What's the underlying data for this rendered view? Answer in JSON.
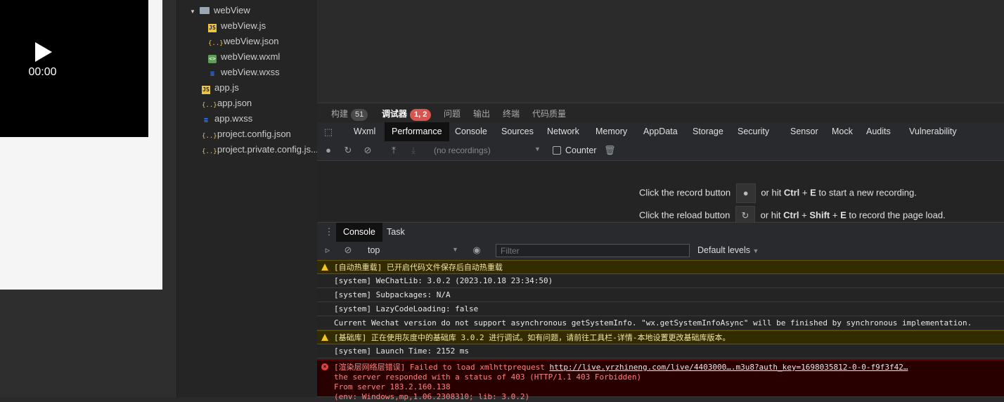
{
  "simulator": {
    "time": "00:00"
  },
  "tree": {
    "folder": "webView",
    "children": [
      {
        "name": "webView.js",
        "type": "js"
      },
      {
        "name": "webView.json",
        "type": "json"
      },
      {
        "name": "webView.wxml",
        "type": "wxml"
      },
      {
        "name": "webView.wxss",
        "type": "wxss"
      }
    ],
    "root": [
      {
        "name": "app.js",
        "type": "js"
      },
      {
        "name": "app.json",
        "type": "json"
      },
      {
        "name": "app.wxss",
        "type": "wxss"
      },
      {
        "name": "project.config.json",
        "type": "json"
      },
      {
        "name": "project.private.config.js...",
        "type": "json"
      }
    ]
  },
  "panelTabs": [
    {
      "label": "构建",
      "badge": "51"
    },
    {
      "label": "调试器",
      "badge": "1, 2",
      "active": true
    },
    {
      "label": "问题"
    },
    {
      "label": "输出"
    },
    {
      "label": "终端"
    },
    {
      "label": "代码质量"
    }
  ],
  "devtoolsTabs": [
    "Wxml",
    "Performance",
    "Console",
    "Sources",
    "Network",
    "Memory",
    "AppData",
    "Storage",
    "Security",
    "Sensor",
    "Mock",
    "Audits",
    "Vulnerability"
  ],
  "devtoolsActive": "Performance",
  "perf": {
    "recordings": "(no recordings)",
    "counter": "Counter",
    "hint1_a": "Click the record button",
    "hint1_b": "or hit",
    "hint1_key": "Ctrl",
    "hint1_plus": "+",
    "hint1_key2": "E",
    "hint1_c": "to start a new recording.",
    "hint2_a": "Click the reload button",
    "hint2_b": "or hit",
    "hint2_key": "Ctrl",
    "hint2_key2": "Shift",
    "hint2_key3": "E",
    "hint2_c": "to record the page load."
  },
  "drawer": {
    "tabs": [
      "Console",
      "Task"
    ],
    "context": "top",
    "filter_placeholder": "Filter",
    "levels": "Default levels"
  },
  "log": [
    {
      "level": "warn",
      "text": "[自动热重载] 已开启代码文件保存后自动热重载"
    },
    {
      "level": "info",
      "text": "[system] WeChatLib: 3.0.2 (2023.10.18 23:34:50)"
    },
    {
      "level": "info",
      "text": "[system] Subpackages: N/A"
    },
    {
      "level": "info",
      "text": "[system] LazyCodeLoading: false"
    },
    {
      "level": "info",
      "text": "Current Wechat version do not support asynchronous getSystemInfo. \"wx.getSystemInfoAsync\" will be finished by synchronous implementation."
    },
    {
      "level": "warn",
      "text": "[基础库] 正在使用灰度中的基础库 3.0.2 进行调试。如有问题，请前往工具栏-详情-本地设置更改基础库版本。"
    },
    {
      "level": "info",
      "text": "[system] Launch Time: 2152 ms"
    }
  ],
  "error": {
    "prefix": "[渲染层网络层错误] Failed to load xmlhttprequest ",
    "link": "http://live.yrzhineng.com/live/4403000….m3u8?auth_key=1698035812-0-0-f9f3f42…",
    "line2": "the server responded with a status of 403 (HTTP/1.1 403 Forbidden)",
    "line3": "From server 183.2.160.138",
    "line4": "(env: Windows,mp,1.06.2308310; lib: 3.0.2)"
  }
}
